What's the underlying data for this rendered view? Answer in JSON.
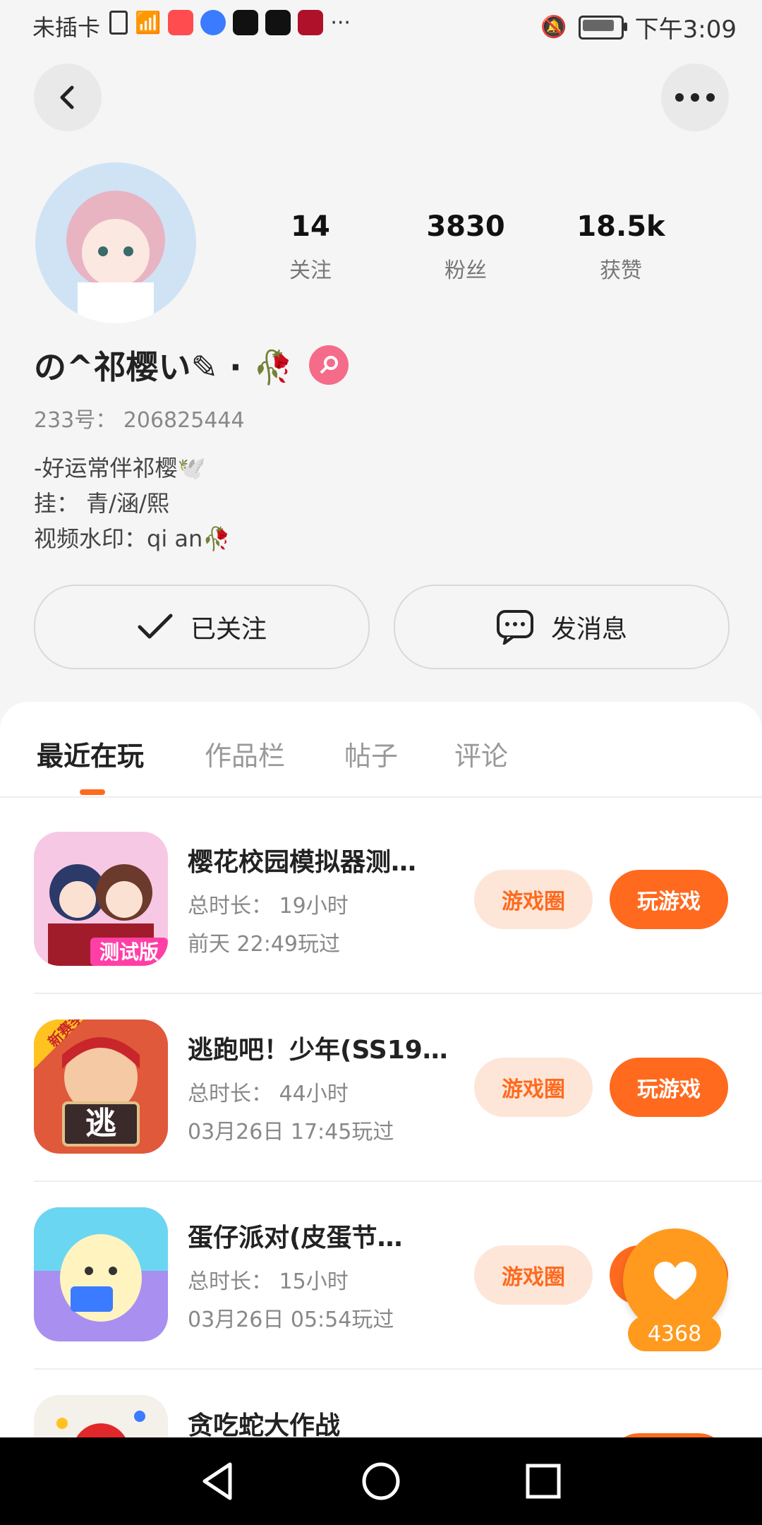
{
  "status_bar": {
    "carrier": "未插卡",
    "more": "···",
    "time": "下午3:09",
    "battery_level": 0.85
  },
  "profile": {
    "stats": [
      {
        "value": "14",
        "label": "关注"
      },
      {
        "value": "3830",
        "label": "粉丝"
      },
      {
        "value": "18.5k",
        "label": "获赞"
      }
    ],
    "nickname": "の^祁樱い✎ · 🥀",
    "id_line": "233号： 206825444",
    "bio": [
      "-好运常伴祁樱🕊️",
      "挂： 青/涵/熙",
      "视频水印：qi an🥀"
    ],
    "follow_label": "已关注",
    "message_label": "发消息"
  },
  "tabs": [
    "最近在玩",
    "作品栏",
    "帖子",
    "评论"
  ],
  "games": [
    {
      "title": "樱花校园模拟器测…",
      "duration": "总时长： 19小时",
      "last_played": "前天 22:49玩过",
      "circle_label": "游戏圈",
      "play_label": "玩游戏"
    },
    {
      "title": "逃跑吧！少年(SS19…",
      "duration": "总时长： 44小时",
      "last_played": "03月26日 17:45玩过",
      "circle_label": "游戏圈",
      "play_label": "玩游戏"
    },
    {
      "title": "蛋仔派对(皮蛋节…",
      "duration": "总时长： 15小时",
      "last_played": "03月26日 05:54玩过",
      "circle_label": "游戏圈",
      "play_label": "玩游戏"
    },
    {
      "title": "贪吃蛇大作战",
      "duration": "",
      "last_played": "",
      "circle_label": "",
      "play_label": ""
    }
  ],
  "like_count": "4368",
  "game_icon_badges": [
    "测试版",
    "新赛季",
    "逃"
  ]
}
